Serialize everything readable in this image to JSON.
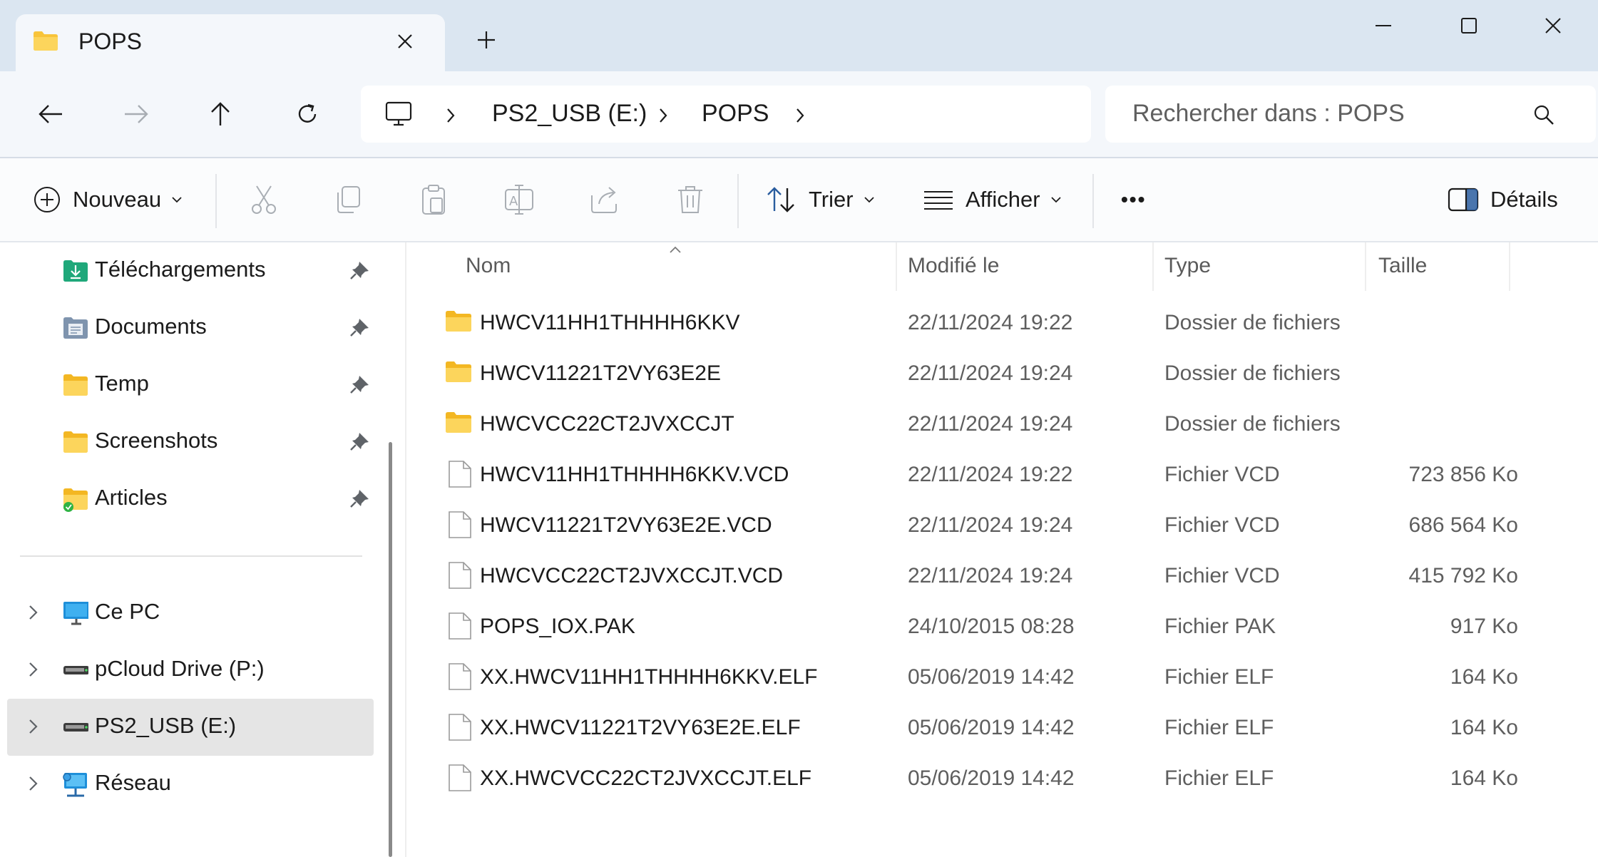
{
  "window": {
    "tab_title": "POPS",
    "new_tab": "+"
  },
  "address": {
    "crumbs": [
      "PS2_USB (E:)",
      "POPS"
    ],
    "search_placeholder": "Rechercher dans : POPS"
  },
  "toolbar": {
    "new_label": "Nouveau",
    "sort_label": "Trier",
    "view_label": "Afficher",
    "more_label": "•••",
    "details_label": "Détails"
  },
  "sidebar": {
    "pinned": [
      {
        "label": "Téléchargements",
        "icon": "downloads-folder-icon"
      },
      {
        "label": "Documents",
        "icon": "documents-folder-icon"
      },
      {
        "label": "Temp",
        "icon": "folder-icon"
      },
      {
        "label": "Screenshots",
        "icon": "folder-icon"
      },
      {
        "label": "Articles",
        "icon": "folder-synced-icon"
      }
    ],
    "locations": [
      {
        "label": "Ce PC",
        "icon": "computer-icon"
      },
      {
        "label": "pCloud Drive (P:)",
        "icon": "drive-icon"
      },
      {
        "label": "PS2_USB (E:)",
        "icon": "drive-icon",
        "selected": true
      },
      {
        "label": "Réseau",
        "icon": "network-icon"
      }
    ]
  },
  "list": {
    "columns": [
      "Nom",
      "Modifié le",
      "Type",
      "Taille"
    ],
    "sort_indicator": "^",
    "rows": [
      {
        "name": "HWCV11HH1THHHH6KKV",
        "date": "22/11/2024 19:22",
        "type": "Dossier de fichiers",
        "size": "",
        "kind": "folder"
      },
      {
        "name": "HWCV11221T2VY63E2E",
        "date": "22/11/2024 19:24",
        "type": "Dossier de fichiers",
        "size": "",
        "kind": "folder"
      },
      {
        "name": "HWCVCC22CT2JVXCCJT",
        "date": "22/11/2024 19:24",
        "type": "Dossier de fichiers",
        "size": "",
        "kind": "folder"
      },
      {
        "name": "HWCV11HH1THHHH6KKV.VCD",
        "date": "22/11/2024 19:22",
        "type": "Fichier VCD",
        "size": "723 856 Ko",
        "kind": "file"
      },
      {
        "name": "HWCV11221T2VY63E2E.VCD",
        "date": "22/11/2024 19:24",
        "type": "Fichier VCD",
        "size": "686 564 Ko",
        "kind": "file"
      },
      {
        "name": "HWCVCC22CT2JVXCCJT.VCD",
        "date": "22/11/2024 19:24",
        "type": "Fichier VCD",
        "size": "415 792 Ko",
        "kind": "file"
      },
      {
        "name": "POPS_IOX.PAK",
        "date": "24/10/2015 08:28",
        "type": "Fichier PAK",
        "size": "917 Ko",
        "kind": "file"
      },
      {
        "name": "XX.HWCV11HH1THHHH6KKV.ELF",
        "date": "05/06/2019 14:42",
        "type": "Fichier ELF",
        "size": "164 Ko",
        "kind": "file"
      },
      {
        "name": "XX.HWCV11221T2VY63E2E.ELF",
        "date": "05/06/2019 14:42",
        "type": "Fichier ELF",
        "size": "164 Ko",
        "kind": "file"
      },
      {
        "name": "XX.HWCVCC22CT2JVXCCJT.ELF",
        "date": "05/06/2019 14:42",
        "type": "Fichier ELF",
        "size": "164 Ko",
        "kind": "file"
      }
    ]
  },
  "colors": {
    "titlebar_bg": "#dbe6f1",
    "selection_bg": "#e5e5e5",
    "folder_yellow": "#f8c43a"
  }
}
